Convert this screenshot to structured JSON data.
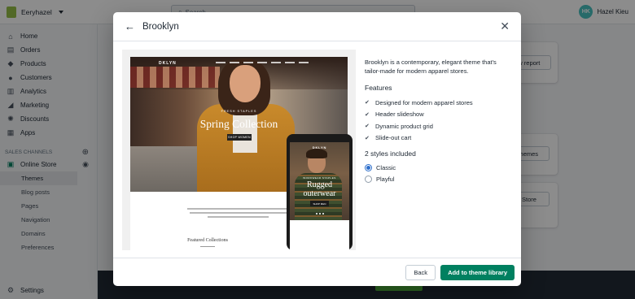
{
  "topbar": {
    "store_name": "Eeryhazel",
    "search_placeholder": "Search",
    "user_initials": "HK",
    "user_name": "Hazel Kieu"
  },
  "sidebar": {
    "items": [
      {
        "label": "Home",
        "icon": "home-icon"
      },
      {
        "label": "Orders",
        "icon": "orders-icon"
      },
      {
        "label": "Products",
        "icon": "tag-icon"
      },
      {
        "label": "Customers",
        "icon": "customers-icon"
      },
      {
        "label": "Analytics",
        "icon": "analytics-icon"
      },
      {
        "label": "Marketing",
        "icon": "marketing-icon"
      },
      {
        "label": "Discounts",
        "icon": "discounts-icon"
      },
      {
        "label": "Apps",
        "icon": "apps-icon"
      }
    ],
    "sales_channels_label": "SALES CHANNELS",
    "online_store_label": "Online Store",
    "sub_items": [
      "Themes",
      "Blog posts",
      "Pages",
      "Navigation",
      "Domains",
      "Preferences"
    ],
    "settings_label": "Settings"
  },
  "background": {
    "view_report_btn": "View report",
    "themes_btn": "Themes",
    "store_btn": "Store"
  },
  "modal": {
    "title": "Brooklyn",
    "description": "Brooklyn is a contemporary, elegant theme that's tailor-made for modern apparel stores.",
    "features_heading": "Features",
    "features": [
      "Designed for modern apparel stores",
      "Header slideshow",
      "Dynamic product grid",
      "Slide-out cart"
    ],
    "styles_heading": "2 styles included",
    "styles": [
      {
        "label": "Classic",
        "selected": true
      },
      {
        "label": "Playful",
        "selected": false
      }
    ],
    "back_label": "Back",
    "primary_label": "Add to theme library",
    "accent_color": "#008060"
  },
  "preview": {
    "desktop_logo": "DKLYN",
    "desktop_kicker": "FRESH STAPLES",
    "desktop_title": "Spring Collection",
    "desktop_button": "SHOP WOMEN",
    "featured_heading": "Featured Collections",
    "mobile_logo": "DKLYN",
    "mobile_kicker": "WORKWEAR STAPLES",
    "mobile_title": "Rugged outerwear",
    "mobile_button": "SHOP MEN"
  }
}
